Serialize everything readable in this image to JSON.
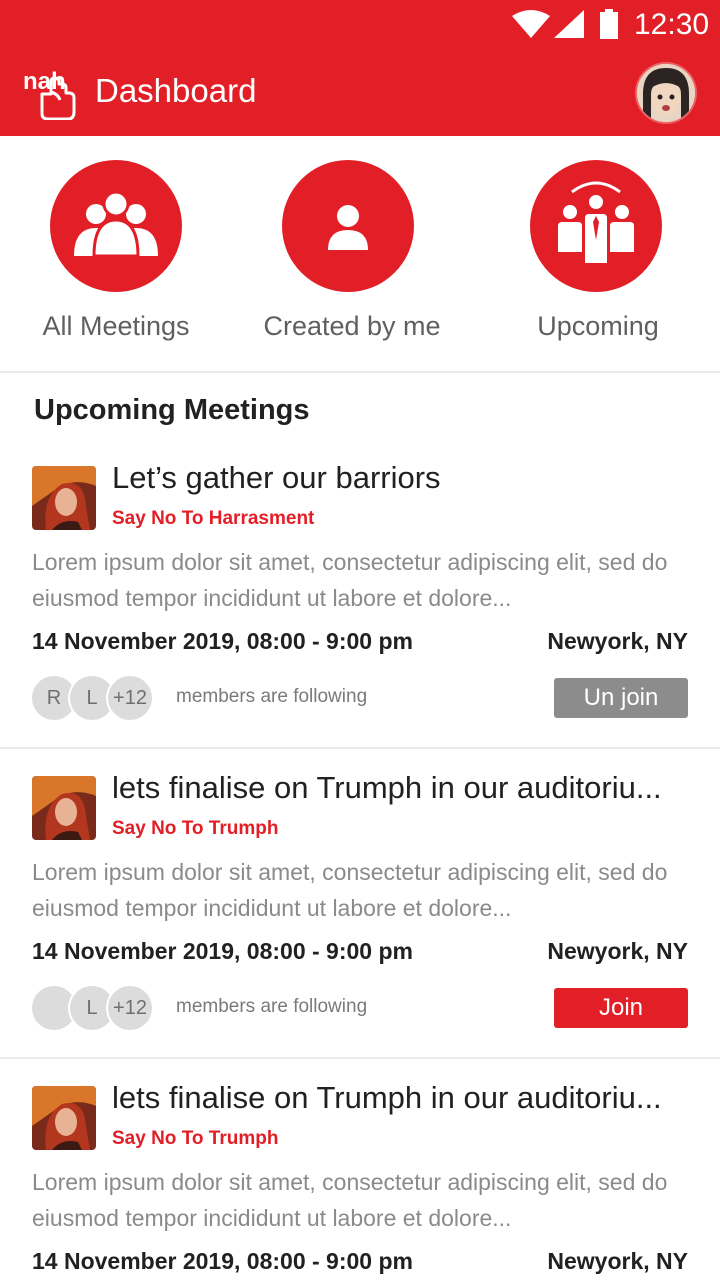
{
  "status_bar": {
    "time": "12:30"
  },
  "toolbar": {
    "logo_text": "nah",
    "title": "Dashboard"
  },
  "quick_actions": [
    {
      "label": "All Meetings",
      "icon": "group-icon"
    },
    {
      "label": "Created by me",
      "icon": "person-icon"
    },
    {
      "label": "Upcoming",
      "icon": "conference-icon"
    }
  ],
  "section_title": "Upcoming Meetings",
  "meetings": [
    {
      "title": "Let’s gather our barriors",
      "subtitle": "Say No To Harrasment",
      "description": "Lorem ipsum dolor sit amet, consectetur adipiscing elit, sed do eiusmod tempor incididunt ut labore et dolore...",
      "datetime": "14 November 2019, 08:00 - 9:00 pm",
      "location": "Newyork, NY",
      "members": [
        "R",
        "L",
        "+12"
      ],
      "members_text": "members are following",
      "button": "Un join"
    },
    {
      "title": "lets finalise on Trumph in our auditoriu...",
      "subtitle": "Say No To Trumph",
      "description": "Lorem ipsum dolor sit amet, consectetur adipiscing elit, sed do eiusmod tempor incididunt ut labore et dolore...",
      "datetime": "14 November 2019, 08:00 - 9:00 pm",
      "location": "Newyork, NY",
      "members": [
        "",
        "L",
        "+12"
      ],
      "members_text": "members are following",
      "button": "Join"
    },
    {
      "title": "lets finalise on Trumph in our auditoriu...",
      "subtitle": "Say No To Trumph",
      "description": "Lorem ipsum dolor sit amet, consectetur adipiscing elit, sed do eiusmod tempor incididunt ut labore et dolore...",
      "datetime": "14 November 2019, 08:00 - 9:00 pm",
      "location": "Newyork, NY"
    }
  ],
  "colors": {
    "accent": "#E21F26",
    "unjoin_button": "#8C8C8C"
  }
}
